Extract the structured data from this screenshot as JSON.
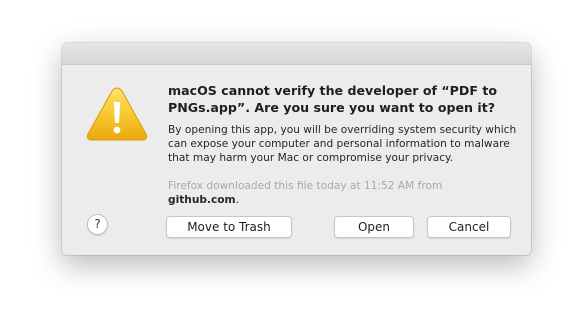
{
  "dialog": {
    "icon": "warning-triangle-icon",
    "heading": "macOS cannot verify the developer of “PDF to PNGs.app”. Are you sure you want to open it?",
    "body": "By opening this app, you will be overriding system security which can expose your computer and personal information to malware that may harm your Mac or compromise your privacy.",
    "source_prefix": "Firefox downloaded this file today at 11:52 AM from",
    "source_domain": "github.com",
    "source_suffix": ".",
    "help_label": "?",
    "buttons": {
      "trash": "Move to Trash",
      "open": "Open",
      "cancel": "Cancel"
    }
  },
  "colors": {
    "dialog_bg": "#ececec",
    "warning_yellow": "#f5c52b",
    "muted_text": "#a8a8a8"
  }
}
